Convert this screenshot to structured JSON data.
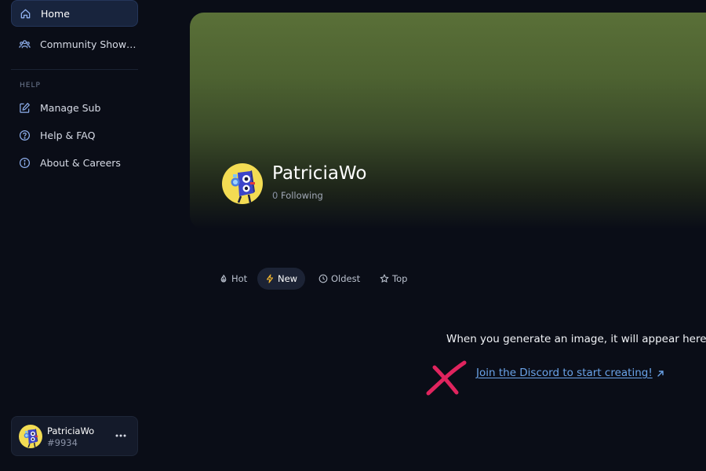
{
  "sidebar": {
    "items": [
      {
        "label": "Home",
        "icon": "home-icon",
        "active": true
      },
      {
        "label": "Community Showcase",
        "icon": "community-icon",
        "active": false
      }
    ],
    "help_section_label": "HELP",
    "help_items": [
      {
        "label": "Manage Sub",
        "icon": "edit-icon"
      },
      {
        "label": "Help & FAQ",
        "icon": "help-circle-icon"
      },
      {
        "label": "About & Careers",
        "icon": "info-icon"
      }
    ]
  },
  "user_card": {
    "name": "PatriciaWo",
    "tag": "#9934",
    "more_icon": "more-horizontal-icon"
  },
  "profile": {
    "name": "PatriciaWo",
    "following_count": "0",
    "following_label": "Following",
    "banner_color": "#5a7038"
  },
  "sort_tabs": [
    {
      "label": "Hot",
      "icon": "flame-icon",
      "active": false
    },
    {
      "label": "New",
      "icon": "bolt-icon",
      "active": true
    },
    {
      "label": "Oldest",
      "icon": "clock-icon",
      "active": false
    },
    {
      "label": "Top",
      "icon": "star-icon",
      "active": false
    }
  ],
  "empty_state": {
    "message": "When you generate an image, it will appear here.",
    "link_label": "Join the Discord to start creating!",
    "link_icon": "external-arrow-icon",
    "annotation": "x-mark",
    "annotation_color": "#e0245e"
  },
  "colors": {
    "background": "#0a0d17",
    "active_nav_bg": "#18243d",
    "link": "#6aa3e8",
    "accent_bolt": "#f5b82e"
  }
}
